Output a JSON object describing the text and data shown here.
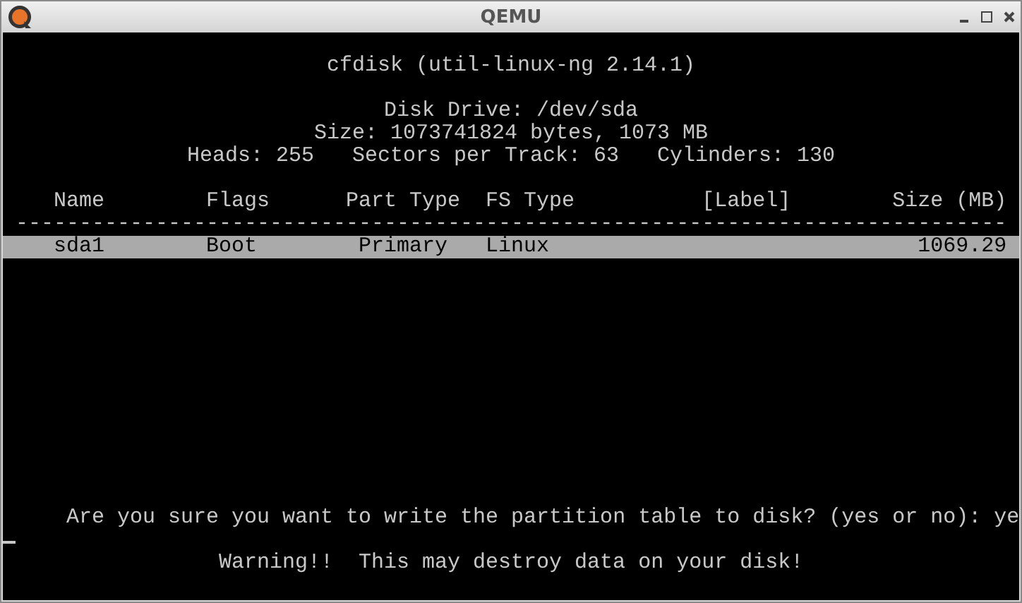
{
  "window": {
    "title": "QEMU"
  },
  "terminal": {
    "header": [
      "cfdisk (util-linux-ng 2.14.1)"
    ],
    "disk_info": [
      "Disk Drive: /dev/sda",
      "Size: 1073741824 bytes, 1073 MB",
      "Heads: 255   Sectors per Track: 63   Cylinders: 130"
    ],
    "table": {
      "columns": [
        "Name",
        "Flags",
        "Part Type",
        "FS Type",
        "[Label]",
        "Size (MB)"
      ],
      "separator": "------------------------------------------------------------------------------",
      "rows": [
        {
          "selected": true,
          "cells": [
            "sda1",
            "Boot",
            "Primary",
            "Linux",
            "",
            "1069.29"
          ]
        }
      ]
    },
    "prompt": "Are you sure you want to write the partition table to disk? (yes or no): ye",
    "warning": "Warning!!  This may destroy data on your disk!"
  }
}
